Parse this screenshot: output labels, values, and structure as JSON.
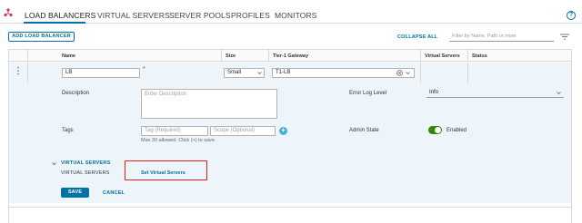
{
  "nav": {
    "tabs": [
      {
        "label": "LOAD BALANCERS"
      },
      {
        "label": "VIRTUAL SERVERS"
      },
      {
        "label": "SERVER POOLS"
      },
      {
        "label": "PROFILES"
      },
      {
        "label": "MONITORS"
      }
    ],
    "help_label": "?"
  },
  "toolbar": {
    "add_label": "ADD LOAD BALANCER",
    "collapse_label": "COLLAPSE ALL",
    "filter_placeholder": "Filter by Name, Path or more"
  },
  "grid": {
    "columns": [
      "Name",
      "Size",
      "Tier-1 Gateway",
      "Virtual Servers",
      "Status"
    ]
  },
  "form": {
    "name_value": "LB",
    "required_mark": "*",
    "size_value": "Small",
    "gateway_value": "T1-LB",
    "description_label": "Description",
    "description_placeholder": "Enter Description",
    "error_log_label": "Error Log Level",
    "error_log_value": "Info",
    "tags_label": "Tags",
    "tag_placeholder": "Tag (Required)",
    "scope_placeholder": "Scope (Optional)",
    "tags_hint": "Max 30 allowed. Click (+) to save.",
    "admin_state_label": "Admin State",
    "admin_state_value": "Enabled",
    "admin_state_on": true,
    "vs_section_title": "VIRTUAL SERVERS",
    "vs_label": "VIRTUAL SERVERS",
    "vs_link": "Set Virtual Servers",
    "save_label": "SAVE",
    "cancel_label": "CANCEL"
  },
  "colors": {
    "accent": "#0072a3",
    "toggle_on": "#318700",
    "highlight": "#e02020"
  }
}
